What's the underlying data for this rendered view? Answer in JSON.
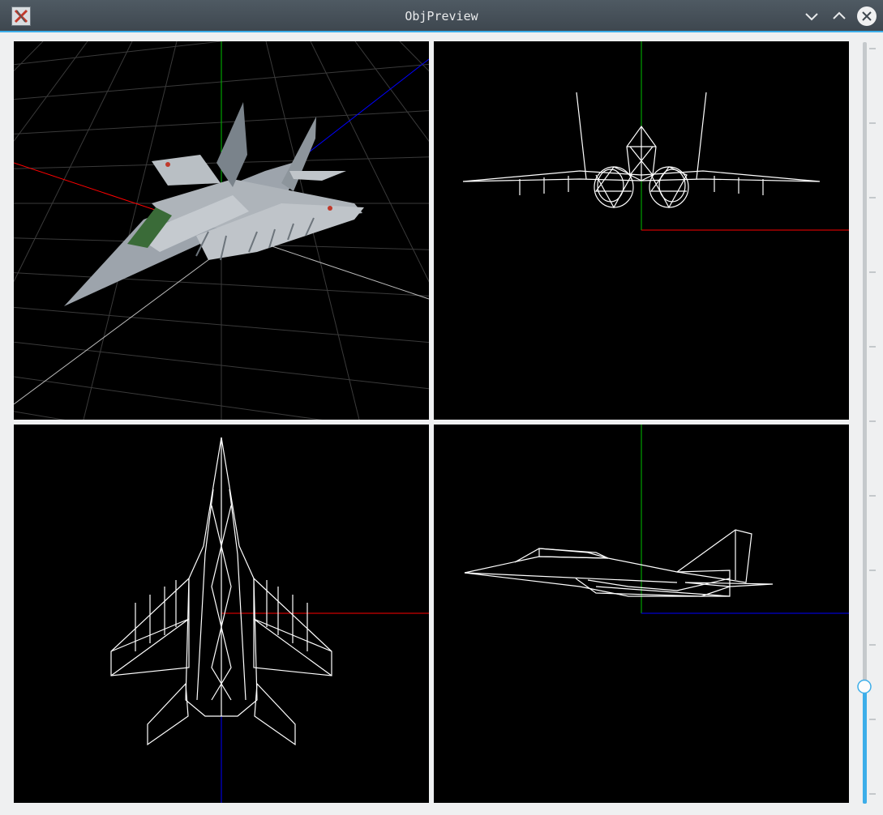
{
  "window": {
    "title": "ObjPreview",
    "app_icon": "x-app-icon",
    "controls": [
      "minimize-icon",
      "maximize-icon",
      "close-icon"
    ]
  },
  "viewports": [
    {
      "name": "perspective",
      "mode": "textured"
    },
    {
      "name": "front",
      "mode": "wireframe"
    },
    {
      "name": "top",
      "mode": "wireframe"
    },
    {
      "name": "side",
      "mode": "wireframe"
    }
  ],
  "zoom_slider": {
    "orientation": "vertical",
    "level": 0.15
  },
  "colors": {
    "accent": "#3daee9",
    "axis_x": "#ff0000",
    "axis_y": "#00c000",
    "axis_z": "#0000ff",
    "wire": "#ffffff",
    "viewport_bg": "#000000"
  }
}
